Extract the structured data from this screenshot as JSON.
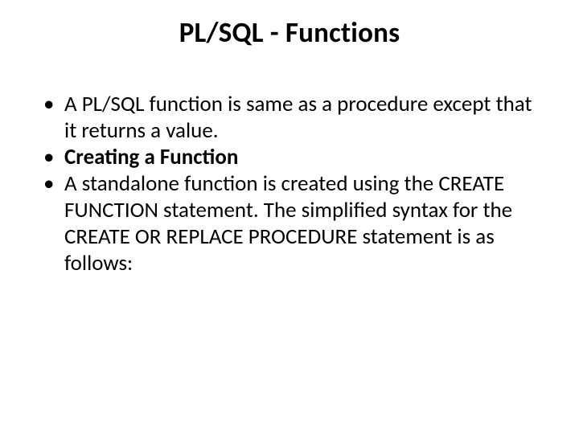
{
  "slide": {
    "title": "PL/SQL - Functions",
    "bullets": [
      {
        "text": "A PL/SQL function is same as a procedure except that it returns a value.",
        "bold": false
      },
      {
        "text": "Creating a Function",
        "bold": true
      },
      {
        "text": "A standalone function is created using the CREATE FUNCTION statement. The simplified syntax for the CREATE OR REPLACE PROCEDURE statement is as follows:",
        "bold": false
      }
    ]
  }
}
